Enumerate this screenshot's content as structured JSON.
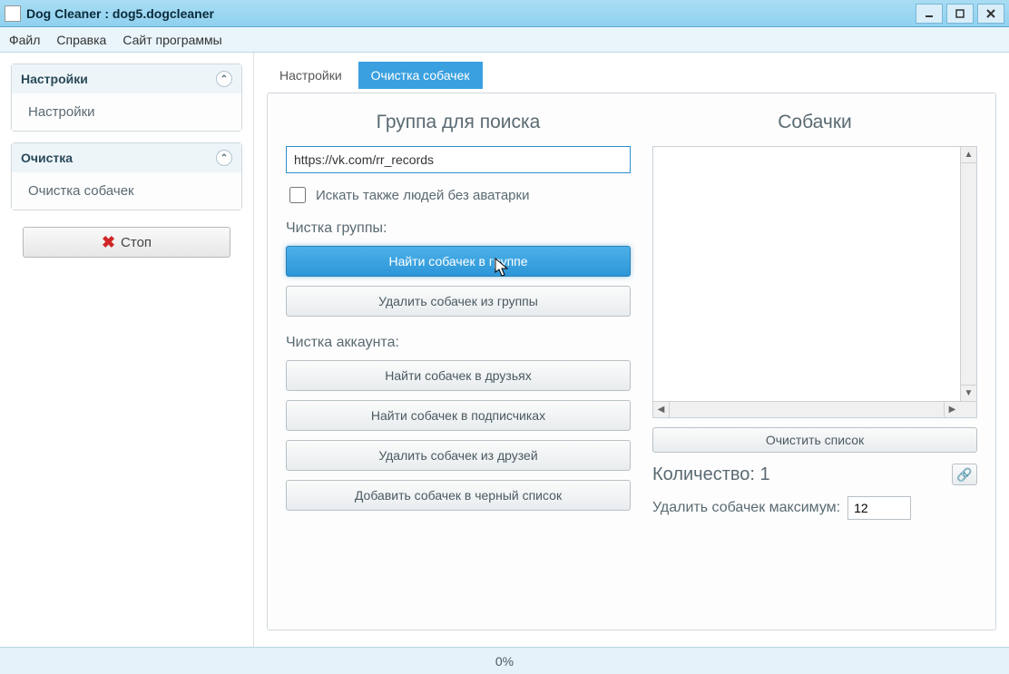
{
  "window": {
    "title": "Dog Cleaner :   dog5.dogcleaner"
  },
  "menu": {
    "file": "Файл",
    "help": "Справка",
    "site": "Сайт программы"
  },
  "sidebar": {
    "settings_header": "Настройки",
    "settings_item": "Настройки",
    "clean_header": "Очистка",
    "clean_item": "Очистка собачек",
    "stop": "Стоп"
  },
  "tabs": {
    "settings": "Настройки",
    "clean": "Очистка собачек"
  },
  "left": {
    "heading": "Группа для поиска",
    "url": "https://vk.com/rr_records",
    "check_label": "Искать также людей без аватарки",
    "group_section": "Чистка группы:",
    "btn_find_group": "Найти собачек в группе",
    "btn_del_group": "Удалить собачек из группы",
    "account_section": "Чистка аккаунта:",
    "btn_find_friends": "Найти собачек в друзьях",
    "btn_find_subs": "Найти собачек в подписчиках",
    "btn_del_friends": "Удалить собачек из друзей",
    "btn_blacklist": "Добавить собачек в черный список"
  },
  "right": {
    "heading": "Собачки",
    "clear_list": "Очистить список",
    "count_label": "Количество:",
    "count_value": "1",
    "max_label": "Удалить собачек максимум:",
    "max_value": "12"
  },
  "status": {
    "progress": "0%"
  }
}
